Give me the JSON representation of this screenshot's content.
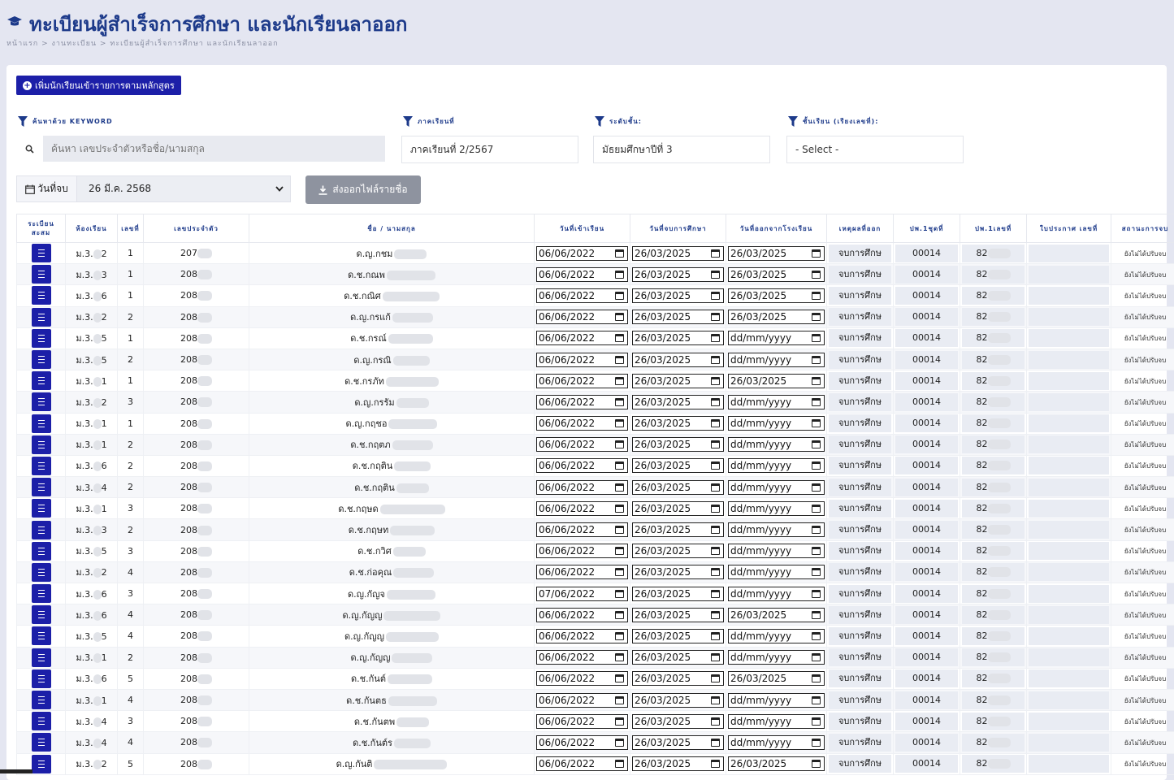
{
  "header": {
    "title": "ทะเบียนผู้สำเร็จการศึกษา และนักเรียนลาออก",
    "breadcrumb": "หน้าแรก > งานทะเบียน > ทะเบียนผู้สำเร็จการศึกษา และนักเรียนลาออก"
  },
  "toolbar": {
    "add_label": "เพิ่มนักเรียนเข้ารายการตามหลักสูตร"
  },
  "filters": {
    "keyword_label": "ค้นหาด้วย KEYWORD",
    "keyword_placeholder": "ค้นหา เลขประจำตัวหรือชื่อ/นามสกุล",
    "term_label": "ภาคเรียนที่",
    "term_value": "ภาคเรียนที่ 2/2567",
    "level_label": "ระดับชั้น:",
    "level_value": "มัธยมศึกษาปีที่ 3",
    "class_label": "ชั้นเรียน (เรียงเลขที่):",
    "class_value": "- Select -",
    "end_date_label": "วันที่จบ",
    "end_date_value": "26 มี.ค. 2568",
    "export_label": "ส่งออกไฟล์รายชื่อ"
  },
  "table": {
    "columns": [
      "ระเบียนสะสม",
      "ห้องเรียน",
      "เลขที่",
      "เลขประจำตัว",
      "ชื่อ / นามสกุล",
      "วันที่เข้าเรียน",
      "วันที่จบการศึกษา",
      "วันที่ออกจากโรงเรียน",
      "เหตุผลที่ออก",
      "ปพ.1ชุดที่",
      "ปพ.1เลขที่",
      "ใบประกาศ เลขที่",
      "สถานะการจบ"
    ],
    "rows": [
      {
        "room": "ม.3.",
        "room_end": "2",
        "no": "1",
        "sid": "207",
        "name": "ด.ญ.กชม",
        "enter": "06/06/2022",
        "grad": "26/03/2025",
        "leave": "26/03/2025",
        "reason": "จบการศึกษ",
        "set": "00014",
        "pno": "82",
        "status": "ยังไม่ได้ปรับจบ"
      },
      {
        "room": "ม.3.",
        "room_end": "3",
        "no": "1",
        "sid": "208",
        "name": "ด.ช.กณพ",
        "enter": "06/06/2022",
        "grad": "26/03/2025",
        "leave": "26/03/2025",
        "reason": "จบการศึกษ",
        "set": "00014",
        "pno": "82",
        "status": "ยังไม่ได้ปรับจบ"
      },
      {
        "room": "ม.3.",
        "room_end": "6",
        "no": "1",
        "sid": "208",
        "name": "ด.ช.กณิศ",
        "enter": "06/06/2022",
        "grad": "26/03/2025",
        "leave": "26/03/2025",
        "reason": "จบการศึกษ",
        "set": "00014",
        "pno": "82",
        "status": "ยังไม่ได้ปรับจบ"
      },
      {
        "room": "ม.3.",
        "room_end": "2",
        "no": "2",
        "sid": "208",
        "name": "ด.ญ.กรแก้",
        "enter": "06/06/2022",
        "grad": "26/03/2025",
        "leave": "26/03/2025",
        "reason": "จบการศึกษ",
        "set": "00014",
        "pno": "82",
        "status": "ยังไม่ได้ปรับจบ"
      },
      {
        "room": "ม.3.",
        "room_end": "5",
        "no": "1",
        "sid": "208",
        "name": "ด.ช.กรณ์",
        "enter": "06/06/2022",
        "grad": "26/03/2025",
        "leave": "dd/mm/yyyy",
        "reason": "จบการศึกษ",
        "set": "00014",
        "pno": "82",
        "status": "ยังไม่ได้ปรับจบ"
      },
      {
        "room": "ม.3.",
        "room_end": "5",
        "no": "2",
        "sid": "208",
        "name": "ด.ญ.กรณิ",
        "enter": "06/06/2022",
        "grad": "26/03/2025",
        "leave": "dd/mm/yyyy",
        "reason": "จบการศึกษ",
        "set": "00014",
        "pno": "82",
        "status": "ยังไม่ได้ปรับจบ"
      },
      {
        "room": "ม.3.",
        "room_end": "1",
        "no": "1",
        "sid": "208",
        "name": "ด.ช.กรภัท",
        "enter": "06/06/2022",
        "grad": "26/03/2025",
        "leave": "26/03/2025",
        "reason": "จบการศึกษ",
        "set": "00014",
        "pno": "82",
        "status": "ยังไม่ได้ปรับจบ"
      },
      {
        "room": "ม.3.",
        "room_end": "2",
        "no": "3",
        "sid": "208",
        "name": "ด.ญ.กรรัม",
        "enter": "06/06/2022",
        "grad": "26/03/2025",
        "leave": "dd/mm/yyyy",
        "reason": "จบการศึกษ",
        "set": "00014",
        "pno": "82",
        "status": "ยังไม่ได้ปรับจบ"
      },
      {
        "room": "ม.3.",
        "room_end": "1",
        "no": "1",
        "sid": "208",
        "name": "ด.ญ.กฤชอ",
        "enter": "06/06/2022",
        "grad": "26/03/2025",
        "leave": "dd/mm/yyyy",
        "reason": "จบการศึกษ",
        "set": "00014",
        "pno": "82",
        "status": "ยังไม่ได้ปรับจบ"
      },
      {
        "room": "ม.3.",
        "room_end": "1",
        "no": "2",
        "sid": "208",
        "name": "ด.ช.กฤตภ",
        "enter": "06/06/2022",
        "grad": "26/03/2025",
        "leave": "dd/mm/yyyy",
        "reason": "จบการศึกษ",
        "set": "00014",
        "pno": "82",
        "status": "ยังไม่ได้ปรับจบ"
      },
      {
        "room": "ม.3.",
        "room_end": "6",
        "no": "2",
        "sid": "208",
        "name": "ด.ช.กฤติน",
        "enter": "06/06/2022",
        "grad": "26/03/2025",
        "leave": "dd/mm/yyyy",
        "reason": "จบการศึกษ",
        "set": "00014",
        "pno": "82",
        "status": "ยังไม่ได้ปรับจบ"
      },
      {
        "room": "ม.3.",
        "room_end": "4",
        "no": "2",
        "sid": "208",
        "name": "ด.ช.กฤติน",
        "enter": "06/06/2022",
        "grad": "26/03/2025",
        "leave": "dd/mm/yyyy",
        "reason": "จบการศึกษ",
        "set": "00014",
        "pno": "82",
        "status": "ยังไม่ได้ปรับจบ"
      },
      {
        "room": "ม.3.",
        "room_end": "1",
        "no": "3",
        "sid": "208",
        "name": "ด.ช.กฤษด",
        "enter": "06/06/2022",
        "grad": "26/03/2025",
        "leave": "dd/mm/yyyy",
        "reason": "จบการศึกษ",
        "set": "00014",
        "pno": "82",
        "status": "ยังไม่ได้ปรับจบ"
      },
      {
        "room": "ม.3.",
        "room_end": "3",
        "no": "2",
        "sid": "208",
        "name": "ด.ช.กฤษท",
        "enter": "06/06/2022",
        "grad": "26/03/2025",
        "leave": "dd/mm/yyyy",
        "reason": "จบการศึกษ",
        "set": "00014",
        "pno": "82",
        "status": "ยังไม่ได้ปรับจบ"
      },
      {
        "room": "ม.3.",
        "room_end": "5",
        "no": "3",
        "sid": "208",
        "name": "ด.ช.กวิศ",
        "enter": "06/06/2022",
        "grad": "26/03/2025",
        "leave": "dd/mm/yyyy",
        "reason": "จบการศึกษ",
        "set": "00014",
        "pno": "82",
        "status": "ยังไม่ได้ปรับจบ"
      },
      {
        "room": "ม.3.",
        "room_end": "2",
        "no": "4",
        "sid": "208",
        "name": "ด.ช.ก่อคุณ",
        "enter": "06/06/2022",
        "grad": "26/03/2025",
        "leave": "dd/mm/yyyy",
        "reason": "จบการศึกษ",
        "set": "00014",
        "pno": "82",
        "status": "ยังไม่ได้ปรับจบ"
      },
      {
        "room": "ม.3.",
        "room_end": "6",
        "no": "3",
        "sid": "208",
        "name": "ด.ญ.กัญจ",
        "enter": "07/06/2022",
        "grad": "26/03/2025",
        "leave": "dd/mm/yyyy",
        "reason": "จบการศึกษ",
        "set": "00014",
        "pno": "82",
        "status": "ยังไม่ได้ปรับจบ"
      },
      {
        "room": "ม.3.",
        "room_end": "6",
        "no": "4",
        "sid": "208",
        "name": "ด.ญ.กัญญ",
        "enter": "06/06/2022",
        "grad": "26/03/2025",
        "leave": "26/03/2025",
        "reason": "จบการศึกษ",
        "set": "00014",
        "pno": "82",
        "status": "ยังไม่ได้ปรับจบ"
      },
      {
        "room": "ม.3.",
        "room_end": "5",
        "no": "4",
        "sid": "208",
        "name": "ด.ญ.กัญญ",
        "enter": "06/06/2022",
        "grad": "26/03/2025",
        "leave": "dd/mm/yyyy",
        "reason": "จบการศึกษ",
        "set": "00014",
        "pno": "82",
        "status": "ยังไม่ได้ปรับจบ"
      },
      {
        "room": "ม.3.",
        "room_end": "1",
        "no": "2",
        "sid": "208",
        "name": "ด.ญ.กัญญ",
        "enter": "06/06/2022",
        "grad": "26/03/2025",
        "leave": "dd/mm/yyyy",
        "reason": "จบการศึกษ",
        "set": "00014",
        "pno": "82",
        "status": "ยังไม่ได้ปรับจบ"
      },
      {
        "room": "ม.3.",
        "room_end": "6",
        "no": "5",
        "sid": "208",
        "name": "ด.ช.กันต์",
        "enter": "06/06/2022",
        "grad": "26/03/2025",
        "leave": "26/03/2025",
        "reason": "จบการศึกษ",
        "set": "00014",
        "pno": "82",
        "status": "ยังไม่ได้ปรับจบ"
      },
      {
        "room": "ม.3.",
        "room_end": "1",
        "no": "4",
        "sid": "208",
        "name": "ด.ช.กันตธ",
        "enter": "06/06/2022",
        "grad": "26/03/2025",
        "leave": "dd/mm/yyyy",
        "reason": "จบการศึกษ",
        "set": "00014",
        "pno": "82",
        "status": "ยังไม่ได้ปรับจบ"
      },
      {
        "room": "ม.3.",
        "room_end": "4",
        "no": "3",
        "sid": "208",
        "name": "ด.ช.กันตพ",
        "enter": "06/06/2022",
        "grad": "26/03/2025",
        "leave": "dd/mm/yyyy",
        "reason": "จบการศึกษ",
        "set": "00014",
        "pno": "82",
        "status": "ยังไม่ได้ปรับจบ"
      },
      {
        "room": "ม.3.",
        "room_end": "4",
        "no": "4",
        "sid": "208",
        "name": "ด.ช.กันต์ร",
        "enter": "06/06/2022",
        "grad": "26/03/2025",
        "leave": "dd/mm/yyyy",
        "reason": "จบการศึกษ",
        "set": "00014",
        "pno": "82",
        "status": "ยังไม่ได้ปรับจบ"
      },
      {
        "room": "ม.3.",
        "room_end": "2",
        "no": "5",
        "sid": "208",
        "name": "ด.ญ.กันติ",
        "enter": "06/06/2022",
        "grad": "26/03/2025",
        "leave": "26/03/2025",
        "reason": "จบการศึกษ",
        "set": "00014",
        "pno": "82",
        "status": "ยังไม่ได้ปรับจบ"
      }
    ]
  }
}
